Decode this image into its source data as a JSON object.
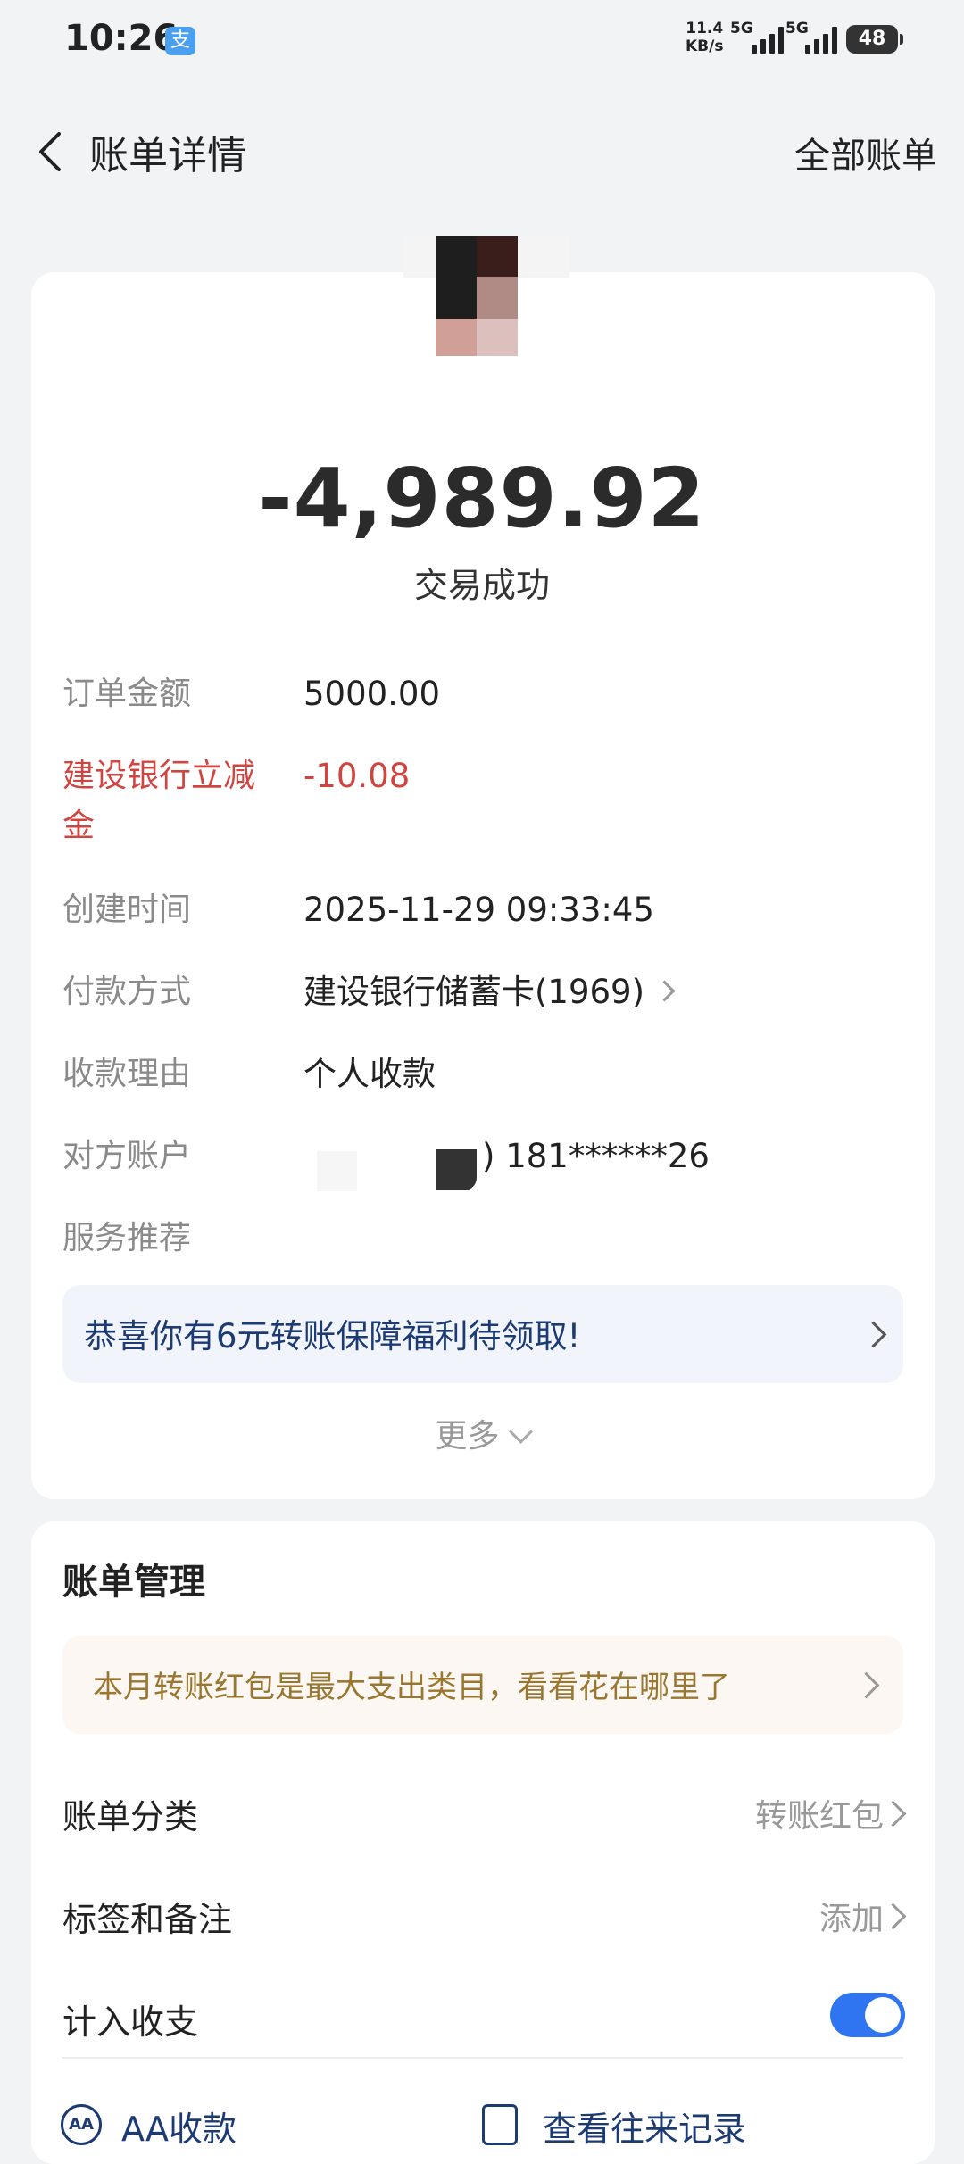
{
  "status_bar": {
    "time": "10:26",
    "app_badge": "支",
    "net_speed_value": "11.4",
    "net_speed_unit": "KB/s",
    "signal1_label": "5G",
    "signal2_label": "5G",
    "battery": "48"
  },
  "nav": {
    "title": "账单详情",
    "right_link": "全部账单"
  },
  "transaction": {
    "amount": "-4,989.92",
    "status": "交易成功"
  },
  "details": [
    {
      "label": "订单金额",
      "value": "5000.00"
    },
    {
      "label": "建设银行立减金",
      "value": "-10.08"
    },
    {
      "label": "创建时间",
      "value": "2025-11-29 09:33:45"
    },
    {
      "label": "付款方式",
      "value": "建设银行储蓄卡(1969)"
    },
    {
      "label": "收款理由",
      "value": "个人收款"
    },
    {
      "label": "对方账户",
      "value": ") 181******26"
    },
    {
      "label": "服务推荐",
      "value": ""
    }
  ],
  "promo": {
    "text": "恭喜你有6元转账保障福利待领取!"
  },
  "more_label": "更多",
  "management": {
    "title": "账单管理",
    "insight": "本月转账红包是最大支出类目，看看花在哪里了",
    "category_label": "账单分类",
    "category_value": "转账红包",
    "tags_label": "标签和备注",
    "tags_value": "添加",
    "include_label": "计入收支",
    "include_enabled": true,
    "aa_label": "AA收款",
    "aa_icon_text": "AA",
    "history_label": "查看往来记录"
  },
  "colors": {
    "accent_blue": "#2f74f0",
    "discount_red": "#d04540",
    "promo_text": "#1d3b73",
    "insight_text": "#9a7730"
  }
}
